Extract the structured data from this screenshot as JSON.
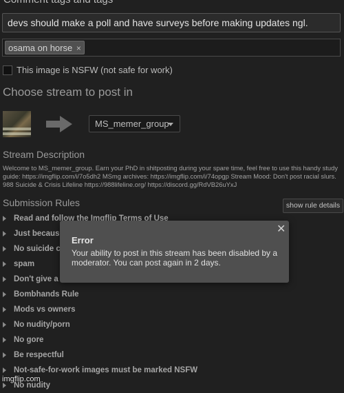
{
  "form": {
    "top_heading": "Comment tags and tags",
    "title_value": "devs should make a poll and have surveys before making updates ngl.",
    "tags": [
      {
        "label": "osama on horse",
        "remove": "×"
      }
    ],
    "nsfw_label": "This image is NSFW (not safe for work)"
  },
  "stream": {
    "heading": "Choose stream to post in",
    "selected": "MS_memer_group",
    "description_heading": "Stream Description",
    "description": "Welcome to MS_memer_group. Earn your PhD in shitposting during your spare time, feel free to use this handy study guide: https://imgflip.com/i/7o5dh2 MSmg archives: https://imgflip.com/i/74opgp Stream Mood: Don't post racial slurs. 988 Suicide & Crisis Lifeline https://988lifeline.org/ https://discord.gg/RdVB26uYxJ"
  },
  "rules": {
    "heading": "Submission Rules",
    "show_button": "show rule details",
    "items": [
      "Read and follow the Imgflip Terms of Use",
      "Just becaus",
      "No suicide c",
      "spam",
      "Don't give a",
      "Bombhands Rule",
      "Mods vs owners",
      "No nudity/porn",
      "No gore",
      "Be respectful",
      "Not-safe-for-work images must be marked NSFW",
      "No nudity"
    ]
  },
  "modal": {
    "title": "Error",
    "message": "Your ability to post in this stream has been disabled by a moderator. You can post again in 2 days.",
    "close": "✕"
  },
  "watermark": "imgflip.com",
  "icons": {
    "arrow": "arrow-right-icon",
    "caret": "chevron-down-icon",
    "close": "close-icon"
  },
  "colors": {
    "background": "#202020",
    "modal": "#4f4f4f"
  }
}
